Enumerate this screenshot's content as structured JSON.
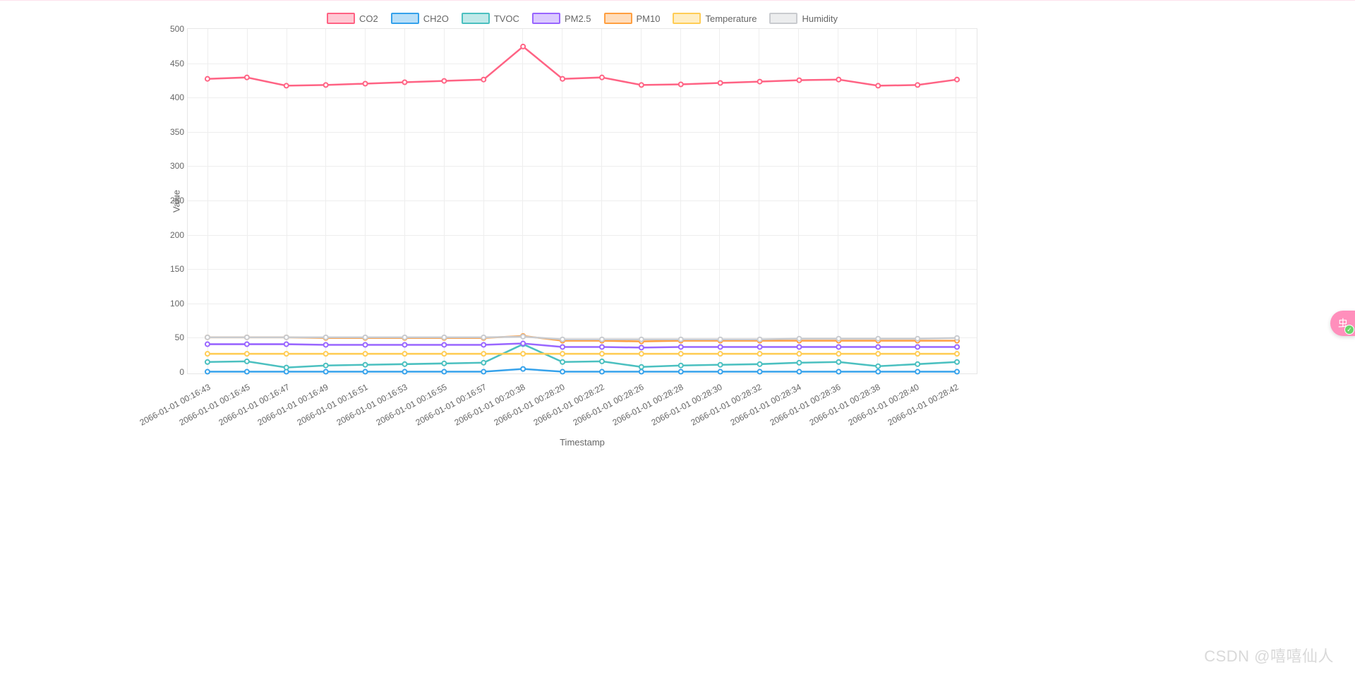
{
  "watermark": "CSDN @嘻嘻仙人",
  "side_badge": {
    "glyph": "虫",
    "check": "✓"
  },
  "chart_data": {
    "type": "line",
    "xlabel": "Timestamp",
    "ylabel": "Value",
    "ylim": [
      0,
      500
    ],
    "yticks": [
      0,
      50,
      100,
      150,
      200,
      250,
      300,
      350,
      400,
      450,
      500
    ],
    "categories": [
      "2066-01-01 00:16:43",
      "2066-01-01 00:16:45",
      "2066-01-01 00:16:47",
      "2066-01-01 00:16:49",
      "2066-01-01 00:16:51",
      "2066-01-01 00:16:53",
      "2066-01-01 00:16:55",
      "2066-01-01 00:16:57",
      "2066-01-01 00:20:38",
      "2066-01-01 00:28:20",
      "2066-01-01 00:28:22",
      "2066-01-01 00:28:26",
      "2066-01-01 00:28:28",
      "2066-01-01 00:28:30",
      "2066-01-01 00:28:32",
      "2066-01-01 00:28:34",
      "2066-01-01 00:28:36",
      "2066-01-01 00:28:38",
      "2066-01-01 00:28:40",
      "2066-01-01 00:28:42"
    ],
    "series": [
      {
        "name": "CO2",
        "color": "#ff6384",
        "values": [
          428,
          430,
          418,
          419,
          421,
          423,
          425,
          427,
          475,
          428,
          430,
          419,
          420,
          422,
          424,
          426,
          427,
          418,
          419,
          427
        ]
      },
      {
        "name": "CH2O",
        "color": "#36a2eb",
        "values": [
          2,
          2,
          2,
          2,
          2,
          2,
          2,
          2,
          6,
          2,
          2,
          2,
          2,
          2,
          2,
          2,
          2,
          2,
          2,
          2
        ]
      },
      {
        "name": "TVOC",
        "color": "#4bc0c0",
        "values": [
          16,
          17,
          8,
          11,
          12,
          13,
          14,
          15,
          42,
          16,
          17,
          9,
          11,
          12,
          13,
          15,
          16,
          10,
          13,
          16
        ]
      },
      {
        "name": "PM2.5",
        "color": "#9966ff",
        "values": [
          42,
          42,
          42,
          41,
          41,
          41,
          41,
          41,
          43,
          38,
          38,
          37,
          38,
          38,
          38,
          38,
          38,
          38,
          38,
          38
        ]
      },
      {
        "name": "PM10",
        "color": "#ff9f40",
        "values": [
          52,
          52,
          52,
          51,
          51,
          51,
          51,
          51,
          54,
          47,
          47,
          46,
          47,
          47,
          47,
          47,
          47,
          47,
          47,
          47
        ]
      },
      {
        "name": "Temperature",
        "color": "#ffcd56",
        "values": [
          28,
          28,
          28,
          28,
          28,
          28,
          28,
          28,
          28,
          28,
          28,
          28,
          28,
          28,
          28,
          28,
          28,
          28,
          28,
          28
        ]
      },
      {
        "name": "Humidity",
        "color": "#c9cbcf",
        "values": [
          52,
          52,
          52,
          52,
          52,
          52,
          52,
          52,
          53,
          49,
          49,
          49,
          49,
          49,
          49,
          50,
          50,
          50,
          50,
          51
        ]
      }
    ]
  }
}
